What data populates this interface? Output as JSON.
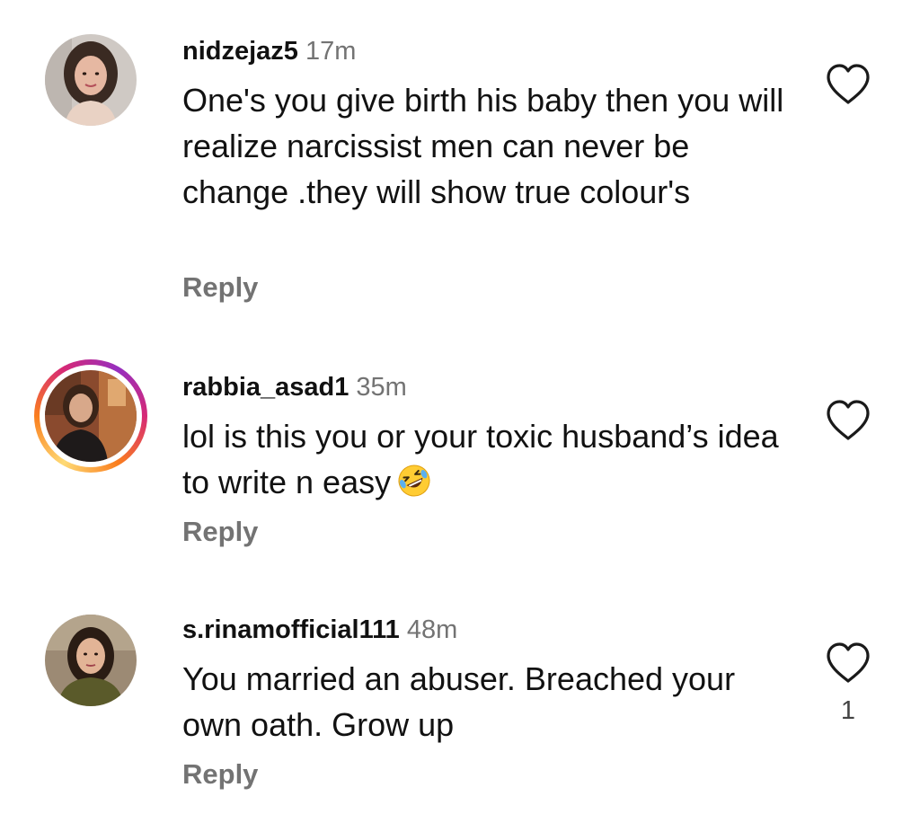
{
  "comments": [
    {
      "username": "nidzejaz5",
      "time": "17m",
      "text": "One's you give birth his baby then you will realize narcissist men can never be change .they will show true colour's",
      "reply_label": "Reply",
      "like_icon": "heart-outline-icon",
      "has_story": false
    },
    {
      "username": "rabbia_asad1",
      "time": "35m",
      "text": "lol is this you or your toxic husband’s idea to write n easy",
      "emoji": "rolling-on-floor-laughing-emoji",
      "reply_label": "Reply",
      "like_icon": "heart-outline-icon",
      "has_story": true
    },
    {
      "username": "s.rinamofficial111",
      "time": "48m",
      "text": "You married an abuser. Breached your own oath. Grow up",
      "reply_label": "Reply",
      "like_icon": "heart-outline-icon",
      "like_count": "1",
      "has_story": false
    }
  ],
  "colors": {
    "text": "#111111",
    "muted": "#737373",
    "story_ring": [
      "#feda75",
      "#fa7e1e",
      "#d62976",
      "#962fbf"
    ]
  }
}
